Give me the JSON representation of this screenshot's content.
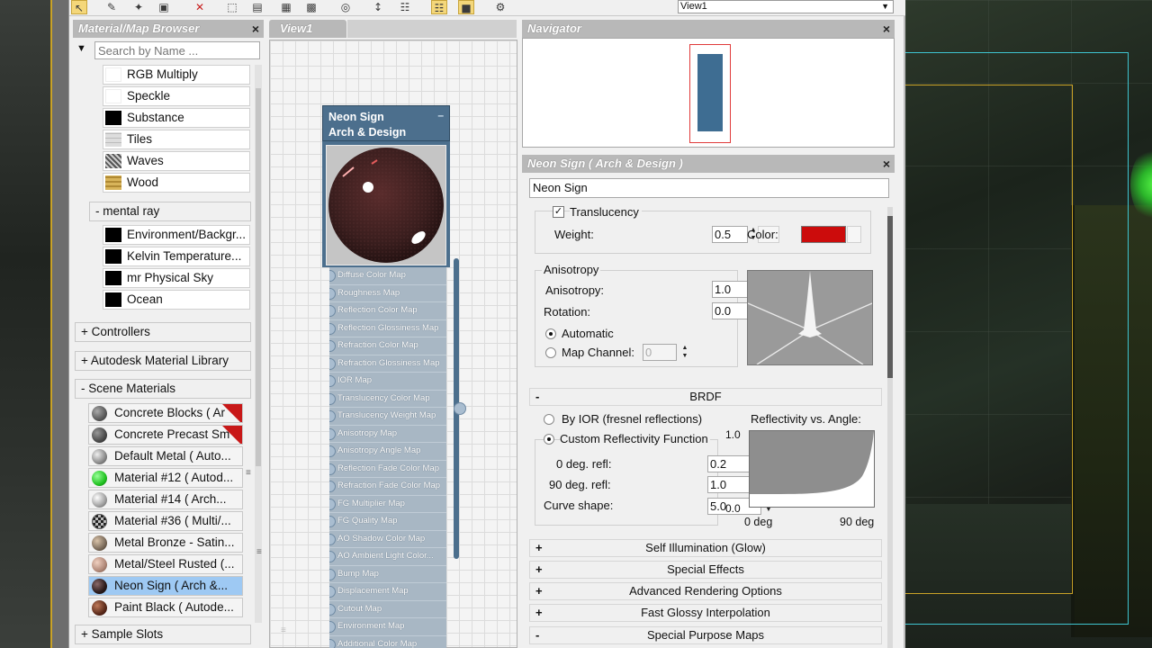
{
  "toolbar": {
    "icons": [
      "select-arrow-icon",
      "eyedropper-icon",
      "pick-material-icon",
      "assign-material-icon",
      "delete-icon",
      "layout-icon",
      "move-children-icon",
      "show-map-icon",
      "background-icon",
      "show-end-result-icon",
      "layout-all-icon",
      "layout-children-icon",
      "hide-unused-icon",
      "active-material-icon",
      "material-map-navigator-icon",
      "options-icon"
    ],
    "view_select_value": "View1"
  },
  "browser": {
    "title": "Material/Map Browser",
    "search_placeholder": "Search by Name ...",
    "maps": [
      {
        "label": "RGB Multiply",
        "swatch": "#ffffff"
      },
      {
        "label": "Speckle",
        "swatch": "#ffffff"
      },
      {
        "label": "Substance",
        "swatch": "#000000"
      },
      {
        "label": "Tiles",
        "swatch": "#d8d8d8"
      },
      {
        "label": "Waves",
        "swatch": "#8a8a8a"
      },
      {
        "label": "Wood",
        "swatch": "#c9a84c"
      }
    ],
    "mental_ray_group": "- mental ray",
    "mental_ray_maps": [
      {
        "label": "Environment/Backgr...",
        "swatch": "#000000"
      },
      {
        "label": "Kelvin Temperature...",
        "swatch": "#000000"
      },
      {
        "label": "mr Physical Sky",
        "swatch": "#000000"
      },
      {
        "label": "Ocean",
        "swatch": "#000000"
      }
    ],
    "groups": {
      "controllers": "+ Controllers",
      "autodesk_library": "+ Autodesk Material Library",
      "scene_materials": "- Scene Materials",
      "sample_slots": "+ Sample Slots"
    },
    "scene_materials": [
      {
        "label": "Concrete Blocks  ( Ar",
        "color": "#6a6a6a",
        "flag": true
      },
      {
        "label": "Concrete Precast Sm",
        "color": "#5a5a5a",
        "flag": true
      },
      {
        "label": "Default Metal  ( Auto...",
        "color": "#8a8a8a",
        "flag": false
      },
      {
        "label": "Material #12  ( Autod...",
        "color": "#22c322",
        "flag": false
      },
      {
        "label": "Material #14  ( Arch...",
        "color": "#a0a0a0",
        "flag": false
      },
      {
        "label": "Material #36  ( Multi/...",
        "color": "#555555",
        "flag": false
      },
      {
        "label": "Metal Bronze - Satin...",
        "color": "#7a6a5a",
        "flag": false
      },
      {
        "label": "Metal/Steel Rusted  (...",
        "color": "#b08878",
        "flag": false
      },
      {
        "label": "Neon Sign  ( Arch &...",
        "color": "#2a1a1a",
        "flag": false,
        "selected": true
      },
      {
        "label": "Paint Black  ( Autode...",
        "color": "#5a2a1a",
        "flag": false
      }
    ]
  },
  "view": {
    "tab_label": "View1",
    "node": {
      "title_line1": "Neon Sign",
      "title_line2": "Arch & Design",
      "minimize": "–",
      "slots": [
        "Diffuse Color Map",
        "Roughness Map",
        "Reflection Color Map",
        "Reflection Glossiness Map",
        "Refraction Color Map",
        "Refraction Glossiness Map",
        "IOR Map",
        "Translucency Color Map",
        "Translucency Weight Map",
        "Anisotropy Map",
        "Anisotropy Angle Map",
        "Reflection Fade Color Map",
        "Refraction Fade Color Map",
        "FG Multiplier Map",
        "FG Quality Map",
        "AO Shadow Color Map",
        "AO Ambient Light Color...",
        "Bump Map",
        "Displacement Map",
        "Cutout Map",
        "Environment Map",
        "Additional Color Map"
      ]
    }
  },
  "navigator": {
    "title": "Navigator"
  },
  "params": {
    "title": "Neon Sign  ( Arch & Design )",
    "name_value": "Neon Sign",
    "translucency": {
      "checkbox_label": "Translucency",
      "checked": true,
      "weight_label": "Weight:",
      "weight_value": "0.5",
      "color_label": "Color:",
      "color": "#cc0c0c"
    },
    "anisotropy": {
      "group_label": "Anisotropy",
      "anisotropy_label": "Anisotropy:",
      "anisotropy_value": "1.0",
      "rotation_label": "Rotation:",
      "rotation_value": "0.0",
      "automatic_label": "Automatic",
      "map_channel_label": "Map Channel:",
      "map_channel_value": "0"
    },
    "brdf": {
      "rollout_label": "BRDF",
      "rollout_sign": "-",
      "by_ior_label": "By IOR (fresnel reflections)",
      "custom_label": "Custom Reflectivity Function",
      "zero_deg_label": "0 deg. refl:",
      "zero_deg_value": "0.2",
      "ninety_deg_label": "90 deg. refl:",
      "ninety_deg_value": "1.0",
      "curve_label": "Curve shape:",
      "curve_value": "5.0",
      "graph_title": "Reflectivity vs. Angle:",
      "y_top": "1.0",
      "y_bottom": "0.0",
      "x_left": "0 deg",
      "x_right": "90 deg"
    },
    "rollouts": [
      {
        "sign": "+",
        "label": "Self Illumination (Glow)"
      },
      {
        "sign": "+",
        "label": "Special Effects"
      },
      {
        "sign": "+",
        "label": "Advanced Rendering Options"
      },
      {
        "sign": "+",
        "label": "Fast Glossy Interpolation"
      },
      {
        "sign": "-",
        "label": "Special Purpose Maps"
      }
    ]
  },
  "glyphs": {
    "close": "×",
    "check": "✓",
    "spin_up": "▲",
    "spin_down": "▼",
    "dropdown": "▼",
    "grip": "≡"
  }
}
